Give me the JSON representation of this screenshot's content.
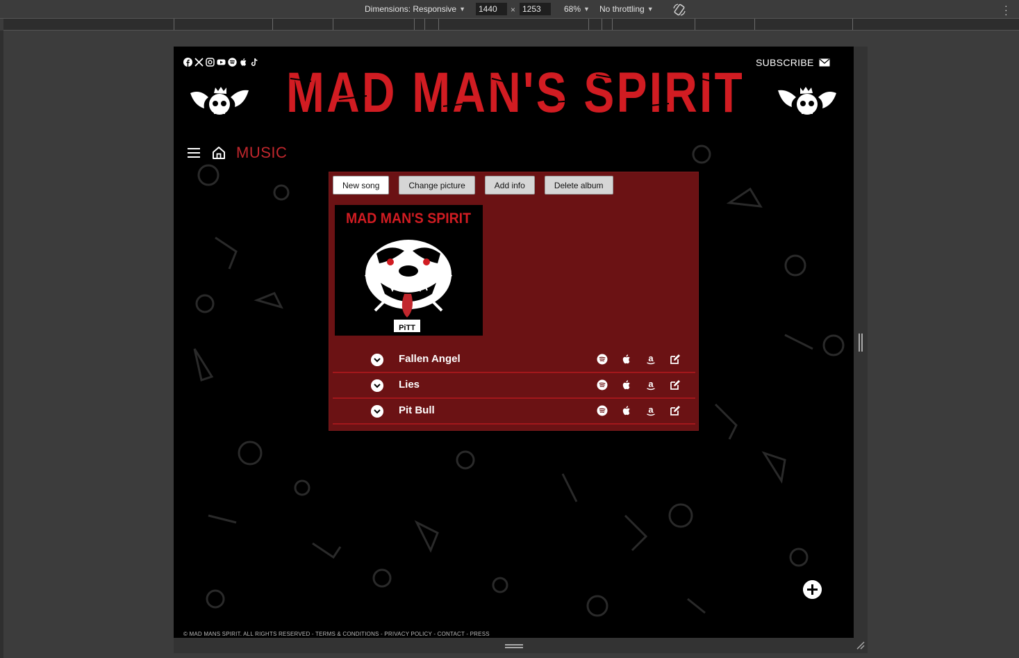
{
  "devtools": {
    "dimensions_label": "Dimensions: Responsive",
    "width_value": "1440",
    "times": "×",
    "height_value": "1253",
    "zoom": "68%",
    "throttling": "No throttling"
  },
  "site": {
    "logo_text": "MAD MAN'S SPIRIT",
    "subscribe_label": "SUBSCRIBE",
    "socials": [
      "facebook-icon",
      "x-icon",
      "instagram-icon",
      "youtube-icon",
      "spotify-icon",
      "apple-icon",
      "tiktok-icon"
    ],
    "nav_title": "MUSIC",
    "footer": "© MAD MANS SPIRIT. ALL RIGHTS RESERVED - TERMS & CONDITIONS - PRIVACY POLICY - CONTACT - PRESS",
    "colors": {
      "brand_red": "#c1272d",
      "panel": "#6b1214",
      "divider": "#a3171b",
      "background": "#000000"
    }
  },
  "album": {
    "buttons": {
      "new_song": "New song",
      "change_picture": "Change picture",
      "add_info": "Add info",
      "delete_album": "Delete album"
    },
    "cover_text": "MAD MAN'S SPIRIT",
    "cover_caption": "PiTT",
    "tracks": [
      {
        "title": "Fallen Angel"
      },
      {
        "title": "Lies"
      },
      {
        "title": "Pit Bull"
      }
    ],
    "track_icons": [
      "spotify-icon",
      "apple-icon",
      "amazon-icon",
      "edit-icon"
    ]
  }
}
